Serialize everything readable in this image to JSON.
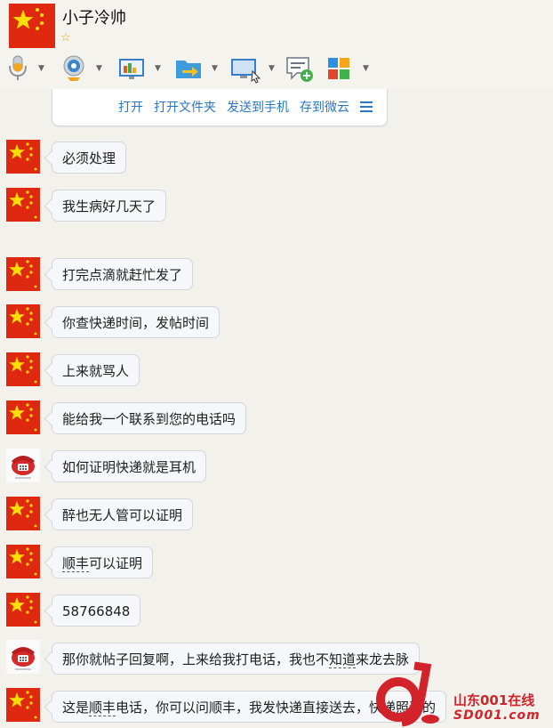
{
  "contact": {
    "name": "小子冷帅"
  },
  "toolbar": {
    "items": [
      {
        "icon": "microphone-icon"
      },
      {
        "icon": "webcam-icon"
      },
      {
        "icon": "screen-share-icon"
      },
      {
        "icon": "transfer-file-icon"
      },
      {
        "icon": "remote-desktop-icon"
      },
      {
        "icon": "new-message-icon"
      },
      {
        "icon": "apps-icon"
      }
    ]
  },
  "file_card": {
    "actions": [
      "打开",
      "打开文件夹",
      "发送到手机",
      "存到微云"
    ]
  },
  "messages": [
    {
      "sender": "flag",
      "text": "必须处理"
    },
    {
      "sender": "flag",
      "text": "我生病好几天了"
    },
    {
      "sender": "flag",
      "text": "打完点滴就赶忙发了"
    },
    {
      "sender": "flag",
      "text": "你查快递时间，发帖时间"
    },
    {
      "sender": "flag",
      "text": "上来就骂人"
    },
    {
      "sender": "flag",
      "text": "能给我一个联系到您的电话吗"
    },
    {
      "sender": "phone",
      "text": "如何证明快递就是耳机"
    },
    {
      "sender": "flag",
      "text": "醉也无人管可以证明"
    },
    {
      "sender": "flag",
      "text_parts": [
        "顺丰",
        "可以证明"
      ]
    },
    {
      "sender": "flag",
      "text": "58766848"
    },
    {
      "sender": "phone",
      "text_parts": [
        "那你就帖子回复啊，上来给我打电话，我也不",
        "知道",
        "来龙去脉"
      ]
    },
    {
      "sender": "flag",
      "text_parts": [
        "这是",
        "顺丰",
        "电话，你可以问顺丰，我发快递直接送去，快递照送的"
      ]
    }
  ],
  "watermark": {
    "cn": "山东001在线",
    "en": "SD001.com"
  },
  "colors": {
    "link": "#2a76c6",
    "flag_red": "#de2910",
    "flag_star": "#ffde00",
    "bubble_bg": "#f6f7fa"
  }
}
